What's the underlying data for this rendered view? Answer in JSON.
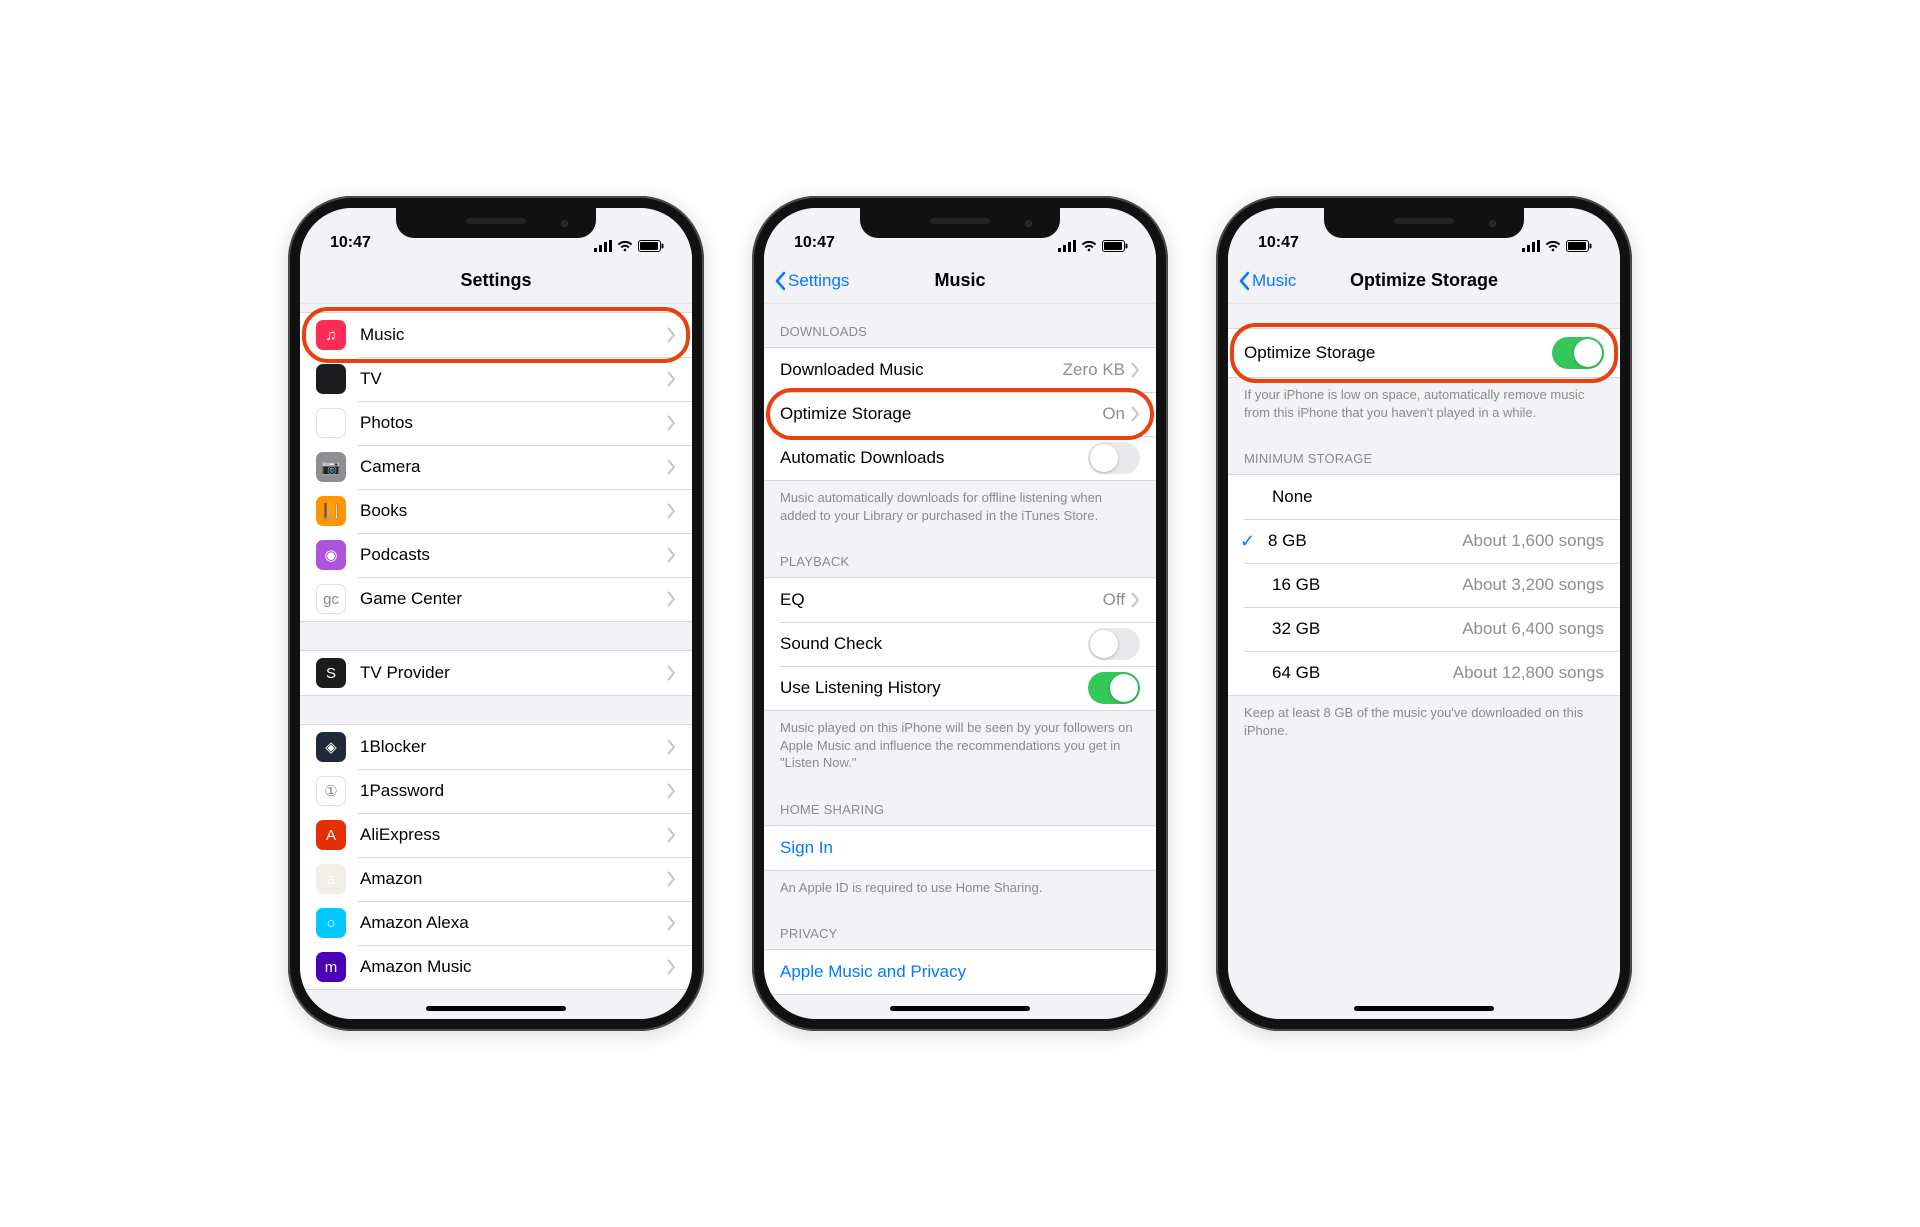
{
  "status": {
    "time": "10:47"
  },
  "phone1": {
    "title": "Settings",
    "groups": [
      {
        "items": [
          {
            "id": "music",
            "label": "Music",
            "bg": "#ff2d55",
            "glyph": "♫",
            "highlight": true
          },
          {
            "id": "tv",
            "label": "TV",
            "bg": "#1c1c1e",
            "glyph": "⽓tv"
          },
          {
            "id": "photos",
            "label": "Photos",
            "bg": "#ffffff",
            "glyph": "flower"
          },
          {
            "id": "camera",
            "label": "Camera",
            "bg": "#8e8e93",
            "glyph": "📷"
          },
          {
            "id": "books",
            "label": "Books",
            "bg": "#ff9500",
            "glyph": "📙"
          },
          {
            "id": "podcasts",
            "label": "Podcasts",
            "bg": "#af52de",
            "glyph": "◉"
          },
          {
            "id": "gamecenter",
            "label": "Game Center",
            "bg": "#ffffff",
            "glyph": "gc"
          }
        ]
      },
      {
        "items": [
          {
            "id": "tvprovider",
            "label": "TV Provider",
            "bg": "#1c1c1e",
            "glyph": "S"
          }
        ]
      },
      {
        "items": [
          {
            "id": "1blocker",
            "label": "1Blocker",
            "bg": "#1e2a3a",
            "glyph": "◈"
          },
          {
            "id": "1password",
            "label": "1Password",
            "bg": "#ffffff",
            "glyph": "①"
          },
          {
            "id": "aliexpress",
            "label": "AliExpress",
            "bg": "#e62e04",
            "glyph": "A"
          },
          {
            "id": "amazon",
            "label": "Amazon",
            "bg": "#f0eee6",
            "glyph": "a"
          },
          {
            "id": "amazon-alexa",
            "label": "Amazon Alexa",
            "bg": "#00c8ff",
            "glyph": "○"
          },
          {
            "id": "amazon-music",
            "label": "Amazon Music",
            "bg": "#4b00b5",
            "glyph": "m"
          }
        ]
      }
    ]
  },
  "phone2": {
    "back": "Settings",
    "title": "Music",
    "sections": [
      {
        "header": "DOWNLOADS",
        "rows": [
          {
            "id": "downloaded",
            "label": "Downloaded Music",
            "value": "Zero KB",
            "chev": true
          },
          {
            "id": "optimize",
            "label": "Optimize Storage",
            "value": "On",
            "chev": true,
            "highlight": true
          },
          {
            "id": "auto",
            "label": "Automatic Downloads",
            "toggle": "off"
          }
        ],
        "footer": "Music automatically downloads for offline listening when added to your Library or purchased in the iTunes Store."
      },
      {
        "header": "PLAYBACK",
        "rows": [
          {
            "id": "eq",
            "label": "EQ",
            "value": "Off",
            "chev": true
          },
          {
            "id": "soundcheck",
            "label": "Sound Check",
            "toggle": "off"
          },
          {
            "id": "history",
            "label": "Use Listening History",
            "toggle": "on"
          }
        ],
        "footer": "Music played on this iPhone will be seen by your followers on Apple Music and influence the recommendations you get in \"Listen Now.\""
      },
      {
        "header": "HOME SHARING",
        "rows": [
          {
            "id": "signin",
            "link": "Sign In"
          }
        ],
        "footer": "An Apple ID is required to use Home Sharing."
      },
      {
        "header": "PRIVACY",
        "rows": [
          {
            "id": "privacy",
            "link": "Apple Music and Privacy"
          }
        ]
      }
    ]
  },
  "phone3": {
    "back": "Music",
    "title": "Optimize Storage",
    "toggleRow": {
      "label": "Optimize Storage",
      "highlight": true
    },
    "toggleFooter": "If your iPhone is low on space, automatically remove music from this iPhone that you haven't played in a while.",
    "storageHeader": "MINIMUM STORAGE",
    "options": [
      {
        "label": "None",
        "detail": "",
        "checked": false
      },
      {
        "label": "8 GB",
        "detail": "About 1,600 songs",
        "checked": true
      },
      {
        "label": "16 GB",
        "detail": "About 3,200 songs",
        "checked": false
      },
      {
        "label": "32 GB",
        "detail": "About 6,400 songs",
        "checked": false
      },
      {
        "label": "64 GB",
        "detail": "About 12,800 songs",
        "checked": false
      }
    ],
    "storageFooter": "Keep at least 8 GB of the music you've downloaded on this iPhone."
  }
}
